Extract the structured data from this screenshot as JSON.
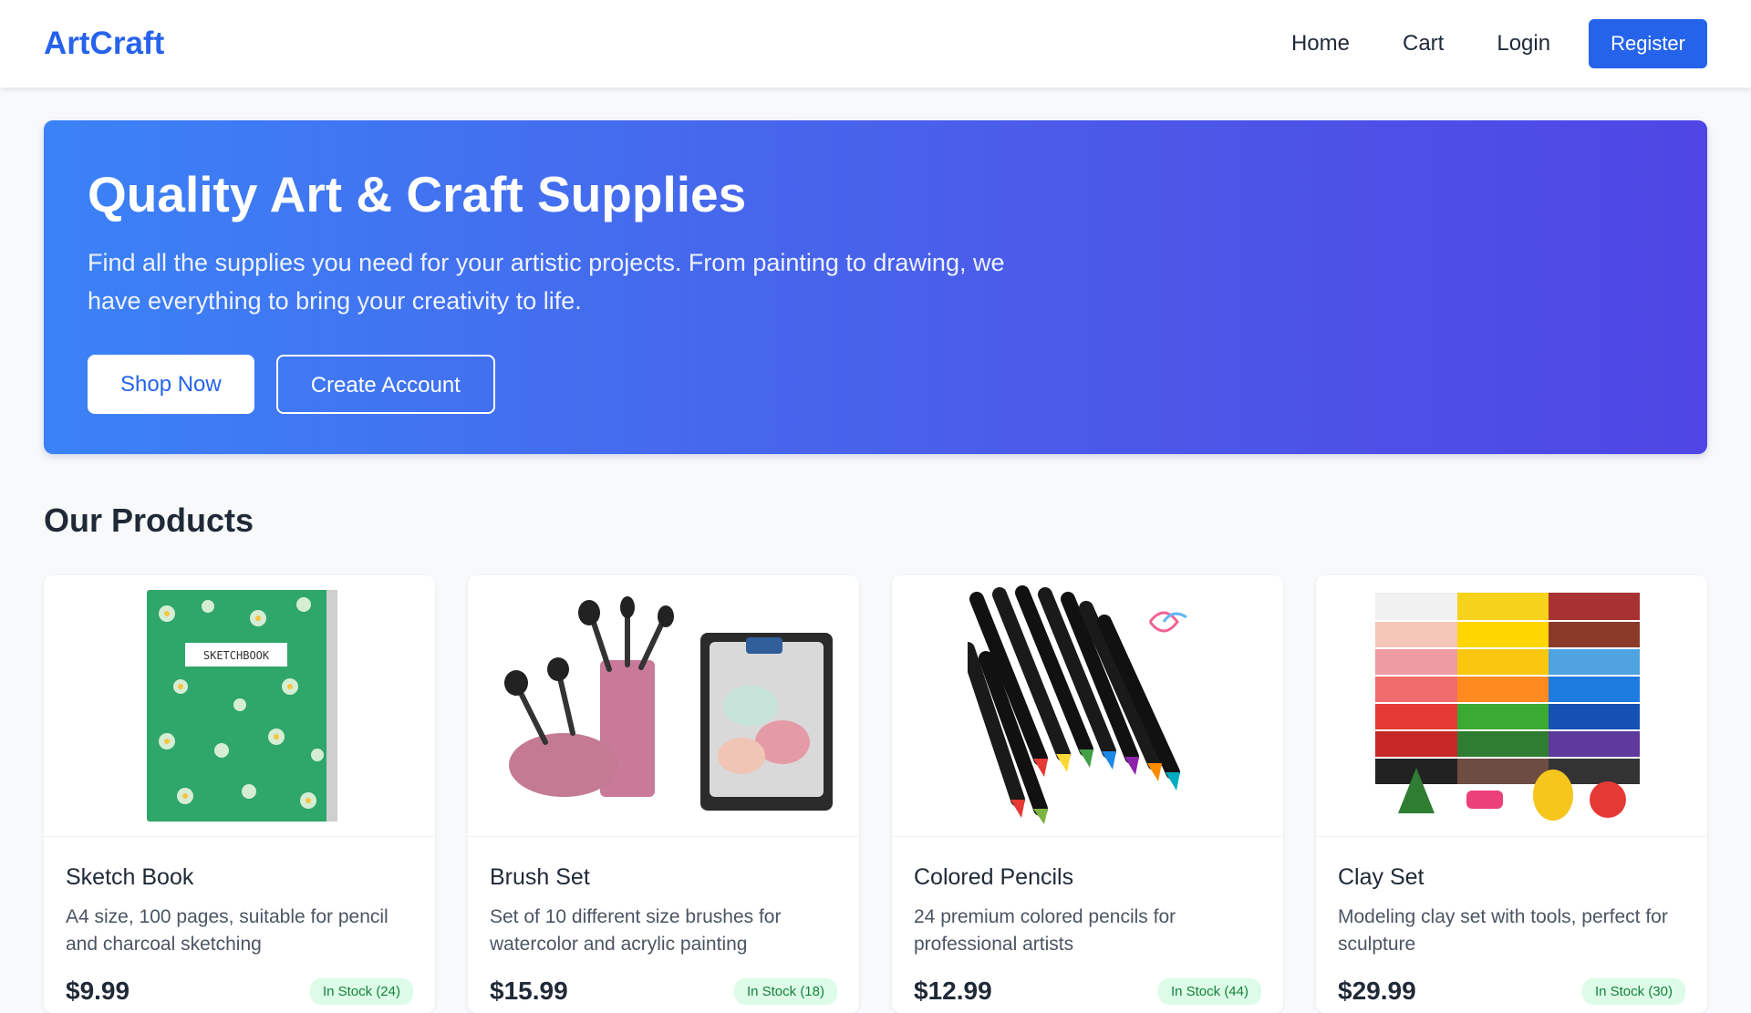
{
  "nav": {
    "brand": "ArtCraft",
    "links": [
      "Home",
      "Cart",
      "Login"
    ],
    "register": "Register"
  },
  "hero": {
    "title": "Quality Art & Craft Supplies",
    "text": "Find all the supplies you need for your artistic projects. From painting to drawing, we have everything to bring your creativity to life.",
    "primary_button": "Shop Now",
    "secondary_button": "Create Account"
  },
  "products_section": {
    "title": "Our Products",
    "items": [
      {
        "name": "Sketch Book",
        "description": "A4 size, 100 pages, suitable for pencil and charcoal sketching",
        "price": "$9.99",
        "stock": "In Stock (24)",
        "cover_label": "SKETCHBOOK"
      },
      {
        "name": "Brush Set",
        "description": "Set of 10 different size brushes for watercolor and acrylic painting",
        "price": "$15.99",
        "stock": "In Stock (18)"
      },
      {
        "name": "Colored Pencils",
        "description": "24 premium colored pencils for professional artists",
        "price": "$12.99",
        "stock": "In Stock (44)"
      },
      {
        "name": "Clay Set",
        "description": "Modeling clay set with tools, perfect for sculpture",
        "price": "$29.99",
        "stock": "In Stock (30)"
      }
    ]
  },
  "colors": {
    "primary": "#2563eb",
    "hero_start": "#3b82f6",
    "hero_end": "#4f46e5",
    "stock_badge_bg": "#dcfce7",
    "stock_badge_text": "#15803d"
  }
}
